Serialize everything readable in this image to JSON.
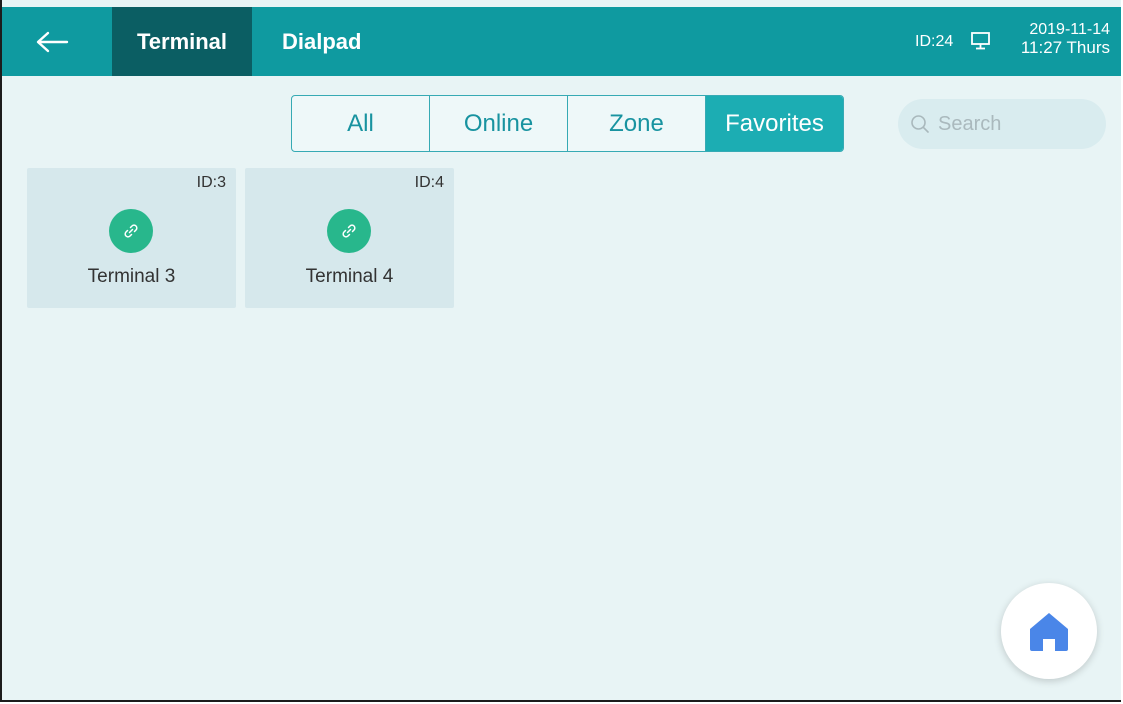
{
  "header": {
    "tabs": [
      {
        "label": "Terminal",
        "active": true
      },
      {
        "label": "Dialpad",
        "active": false
      }
    ],
    "device_id": "ID:24",
    "date": "2019-11-14",
    "time": "11:27 Thurs"
  },
  "filters": {
    "options": [
      "All",
      "Online",
      "Zone",
      "Favorites"
    ],
    "selected": "Favorites"
  },
  "search": {
    "placeholder": "Search",
    "value": ""
  },
  "terminals": [
    {
      "id_label": "ID:3",
      "name": "Terminal 3",
      "icon": "link-icon"
    },
    {
      "id_label": "ID:4",
      "name": "Terminal 4",
      "icon": "link-icon"
    }
  ],
  "colors": {
    "header": "#0f9aa0",
    "active_tab": "#0b5e63",
    "accent": "#1cadb3",
    "status_online": "#28b78c",
    "background": "#e8f4f5",
    "home_icon": "#4a86e8"
  }
}
